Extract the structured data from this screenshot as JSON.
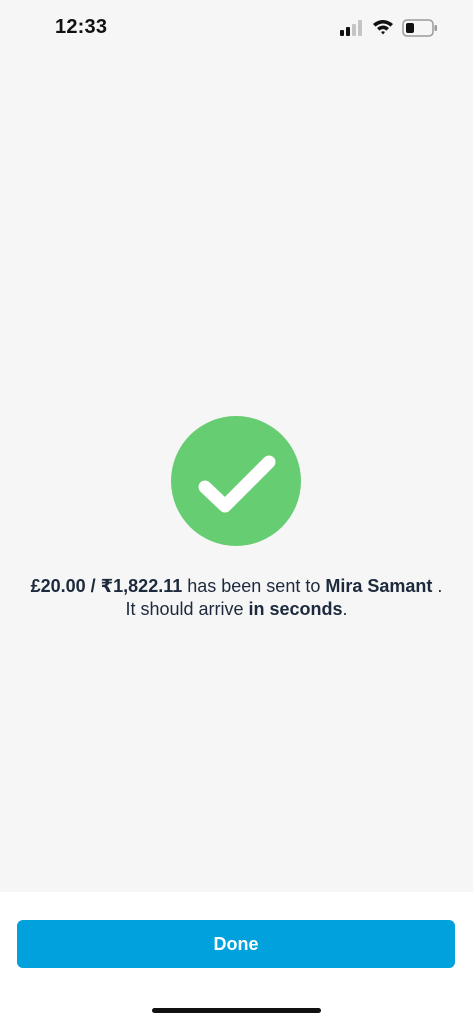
{
  "status_bar": {
    "time": "12:33",
    "icons": [
      "cellular-signal-icon",
      "wifi-icon",
      "battery-icon"
    ]
  },
  "success": {
    "icon": "checkmark-icon",
    "icon_color": "#66cd72",
    "amount": "£20.00 / ₹1,822.11",
    "text_sent_to": " has been sent to ",
    "recipient": "Mira Samant",
    "text_arrive": " . It should arrive ",
    "arrival": "in seconds",
    "text_end": "."
  },
  "footer": {
    "done_label": "Done",
    "button_color": "#00a1dc"
  }
}
